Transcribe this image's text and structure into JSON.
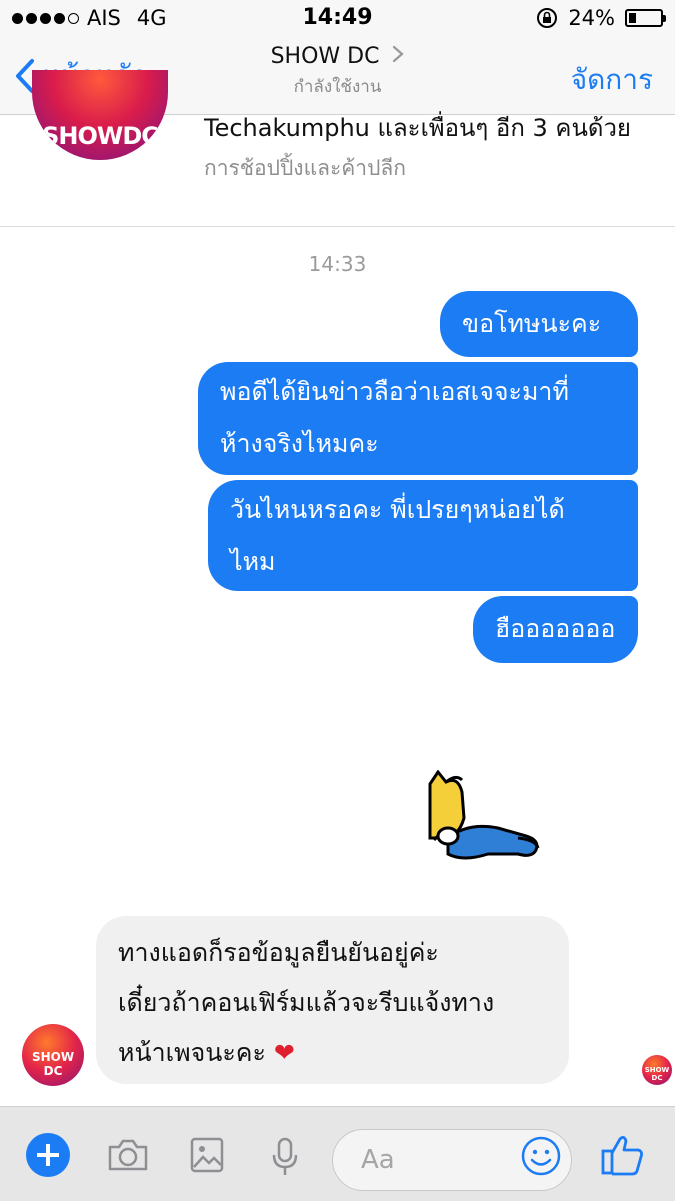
{
  "status_bar": {
    "carrier": "AIS",
    "network": "4G",
    "time": "14:49",
    "battery": "24%",
    "battery_level": 0.24
  },
  "nav": {
    "back_label": "หน้าหลัก",
    "title": "SHOW DC",
    "subtitle": "กำลังใช้งาน",
    "manage_label": "จัดการ"
  },
  "page_header": {
    "logo_text": "SHOWDC",
    "friends_line": "Techakumphu และเพื่อนๆ อีก 3 คนด้วย",
    "category": "การช้อปปิ้งและค้าปลีก"
  },
  "conversation": {
    "timestamp": "14:33",
    "outgoing": [
      {
        "line1": "ขอโทษนะคะ",
        "line2": ""
      },
      {
        "line1": "พอดีได้ยินข่าวลือว่าเอสเจจะมาที่",
        "line2": "ห้างจริงไหมคะ"
      },
      {
        "line1": "วันไหนหรอคะ พี่เปรยๆหน่อยได้",
        "line2": "ไหม"
      },
      {
        "line1": "ฮือออออออ",
        "line2": ""
      }
    ],
    "incoming": {
      "line1": "ทางแอดก็รอข้อมูลยืนยันอยู่ค่ะ",
      "line2": "เดี๋ยวถ้าคอนเฟิร์มแล้วจะรีบแจ้งทาง",
      "line3": "หน้าเพจนะคะ",
      "emoji": "❤"
    },
    "avatar_text": "SHOW DC"
  },
  "composer": {
    "placeholder": "Aa"
  },
  "colors": {
    "accent": "#1c7cf4",
    "incoming_bubble": "#f1f0f0"
  },
  "icons": [
    "chevron-left-icon",
    "chevron-right-icon",
    "lock-rotation-icon",
    "battery-icon",
    "plus-icon",
    "camera-icon",
    "image-icon",
    "microphone-icon",
    "emoji-icon",
    "thumbs-up-icon"
  ]
}
